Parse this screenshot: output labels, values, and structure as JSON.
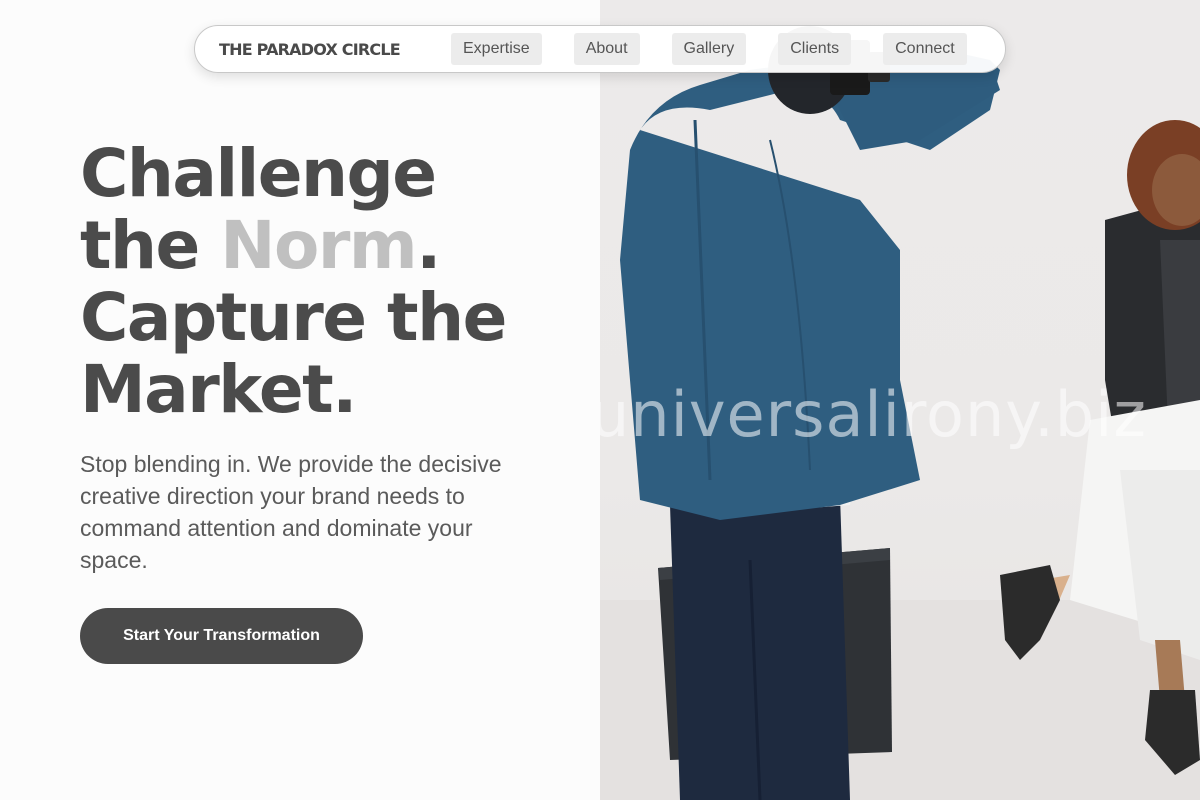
{
  "nav": {
    "brand": "THE PARADOX CIRCLE",
    "links": [
      "Expertise",
      "About",
      "Gallery",
      "Clients",
      "Connect"
    ]
  },
  "hero": {
    "headline": {
      "line1": "Challenge",
      "line2_prefix": "the ",
      "line2_accent": "Norm",
      "line2_suffix": ".",
      "line3": "Capture the",
      "line4": "Market."
    },
    "subtext": "Stop blending in. We provide the decisive creative direction your brand needs to command attention and dominate your space.",
    "cta_label": "Start Your Transformation"
  },
  "photo": {
    "watermark": "universalirony.biz"
  },
  "colors": {
    "text_dark": "#4a4a4a",
    "accent_muted": "#c0c0c0",
    "cta_bg": "#4a4a4a",
    "nav_item_bg": "#ececec"
  }
}
